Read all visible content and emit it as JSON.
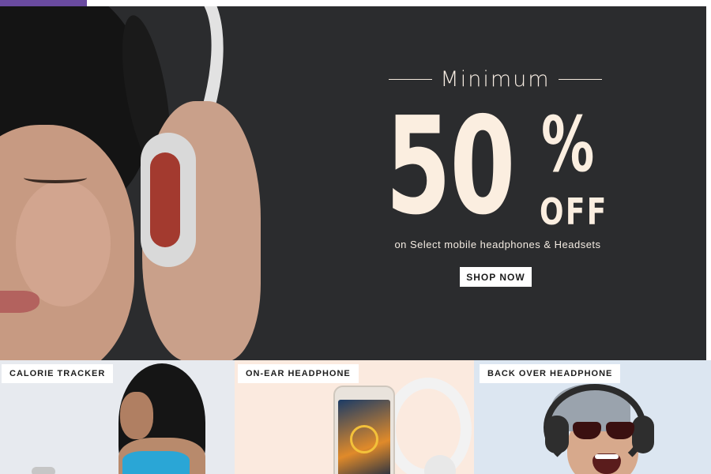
{
  "hero": {
    "minimum": "Minimum",
    "discount_number": "50",
    "percent_sign": "%",
    "off": "OFF",
    "subline": "on Select mobile headphones & Headsets",
    "cta": "SHOP NOW"
  },
  "tiles": [
    {
      "label": "CALORIE TRACKER"
    },
    {
      "label": "ON-EAR HEADPHONE"
    },
    {
      "label": "BACK OVER HEADPHONE"
    }
  ],
  "colors": {
    "hero_background": "#2b2c2e",
    "promo_text": "#fbeee0",
    "accent_bar": "#6a4ba0",
    "button_background": "#ffffff"
  }
}
